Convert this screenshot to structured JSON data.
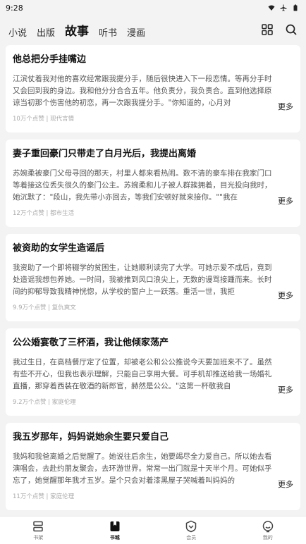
{
  "status": {
    "time": "9:28"
  },
  "nav": {
    "tabs": [
      {
        "label": "小说"
      },
      {
        "label": "出版"
      },
      {
        "label": "故事"
      },
      {
        "label": "听书"
      },
      {
        "label": "漫画"
      }
    ],
    "active_tab": "故事"
  },
  "stories": [
    {
      "title": "他总把分手挂嘴边",
      "excerpt": "江滨仗着我对他的喜欢经常跟我提分手，随后很快进入下一段恋情。等再分手时又会回到我的身边。我和他分分合合五年。他负责分，我负责合。直到他选择原谅当初那个伤害他的初恋，再一次跟我提分手。\"你知道的，心月对",
      "more": "更多",
      "meta": "10万个点赞 | 现代言情"
    },
    {
      "title": "妻子重回豪门只带走了白月光后，我提出离婚",
      "excerpt": "苏婉柔被豪门父母寻回的那天，村里人都来看热闹。数不清的豪车排在我家门口等着接这位丢失很久的豪门公主。苏婉柔和儿子被人群簇拥着，目光投向我时，她沉默了：\"段山，我先带小亦回去，等我们安顿好就来接你。\"\"我在",
      "more": "更多",
      "meta": "12万个点赞 | 都市生活"
    },
    {
      "title": "被资助的女学生造谣后",
      "excerpt": "我资助了一个即将辍学的贫困生，让她顺利读完了大学。可她示爱不成后，竟到处造谣我想包养她。一时间，我被推到风口浪尖上，无数的谩骂接踵而来。长时间的抑郁导致我精神恍惚，从学校的窗户上一跃落。重活一世，我拒",
      "more": "更多",
      "meta": "9.9万个点赞 | 复仇爽文"
    },
    {
      "title": "公公婚宴敬了三杯酒，我让他倾家荡产",
      "excerpt": "我过生日，在高档餐厅定了位置，却被老公和公公推说今天要加班来不了。虽然有些不开心，但我也表示理解，只能自己享用大餐。可手机却推送给我一场婚礼直播，那穿着西装在敬酒的新郎官，赫然是公公。\"这第一杯敬我自",
      "more": "更多",
      "meta": "9.2万个点赞 | 家庭伦理"
    },
    {
      "title": "我五岁那年，妈妈说她余生要只爱自己",
      "excerpt": "我妈和我爸离婚之后觉醒了。她说往后余生，她要竭尽全力爱自己。所以她去看演唱会，去赴约朋友聚会，去环游世界。常常一出门就是十天半个月。可她似乎忘了，她觉醒那年我才五岁。是个只会对着漆黑屋子哭喊着叫妈妈的",
      "more": "更多",
      "meta": "11万个点赞 | 家庭伦理"
    }
  ],
  "bottom_nav": [
    {
      "label": "书架",
      "icon": "bookshelf-icon"
    },
    {
      "label": "书城",
      "icon": "bookstore-icon"
    },
    {
      "label": "会员",
      "icon": "vip-icon"
    },
    {
      "label": "我的",
      "icon": "profile-icon"
    }
  ]
}
